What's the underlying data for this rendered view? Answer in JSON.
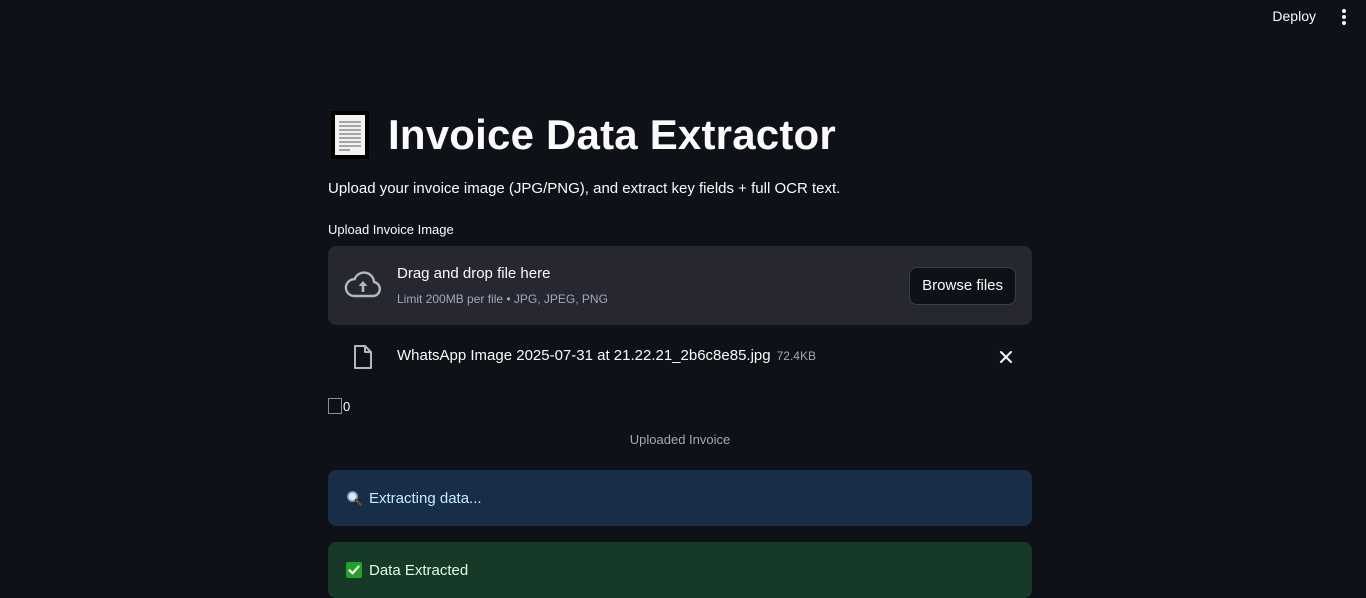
{
  "topbar": {
    "deploy_label": "Deploy",
    "menu_icon": "kebab-menu-icon"
  },
  "page": {
    "title_icon": "page-facing-up-icon",
    "title": "Invoice Data Extractor",
    "subtitle": "Upload your invoice image (JPG/PNG), and extract key fields + full OCR text."
  },
  "uploader": {
    "label": "Upload Invoice Image",
    "drop_title": "Drag and drop file here",
    "limit_text": "Limit 200MB per file • JPG, JPEG, PNG",
    "browse_label": "Browse files",
    "upload_icon": "cloud-upload-icon"
  },
  "uploaded_file": {
    "icon": "file-icon",
    "name": "WhatsApp Image 2025-07-31 at 21.22.21_2b6c8e85.jpg",
    "size": "72.4KB",
    "remove_icon": "close-icon"
  },
  "image": {
    "alt_text": "0",
    "caption": "Uploaded Invoice"
  },
  "alerts": {
    "info_icon": "magnifying-glass-icon",
    "info_text": "Extracting data...",
    "success_icon": "check-mark-icon",
    "success_text": "Data Extracted"
  },
  "colors": {
    "background": "#0e1117",
    "dropzone": "#262730",
    "info_bg": "#172d48",
    "info_text": "#c7ebff",
    "success_bg": "#173928",
    "success_text": "#dffde9",
    "check_green": "#21a32b"
  }
}
